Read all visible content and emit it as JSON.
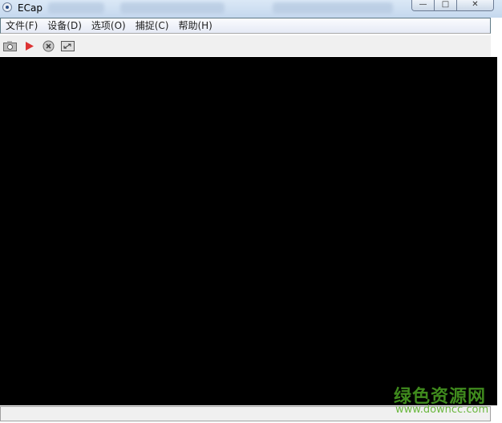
{
  "window": {
    "title": "ECap",
    "controls": {
      "minimize": "—",
      "maximize": "□",
      "close": "✕"
    }
  },
  "menu": {
    "items": [
      {
        "label": "文件(F)"
      },
      {
        "label": "设备(D)"
      },
      {
        "label": "选项(O)"
      },
      {
        "label": "捕捉(C)"
      },
      {
        "label": "帮助(H)"
      }
    ]
  },
  "toolbar": {
    "buttons": [
      {
        "icon": "camera-icon"
      },
      {
        "icon": "play-icon"
      },
      {
        "icon": "stop-icon"
      },
      {
        "icon": "fullscreen-icon"
      }
    ]
  },
  "status": {
    "text": ""
  },
  "watermark": {
    "name": "绿色资源网",
    "url": "www.downcc.com"
  }
}
